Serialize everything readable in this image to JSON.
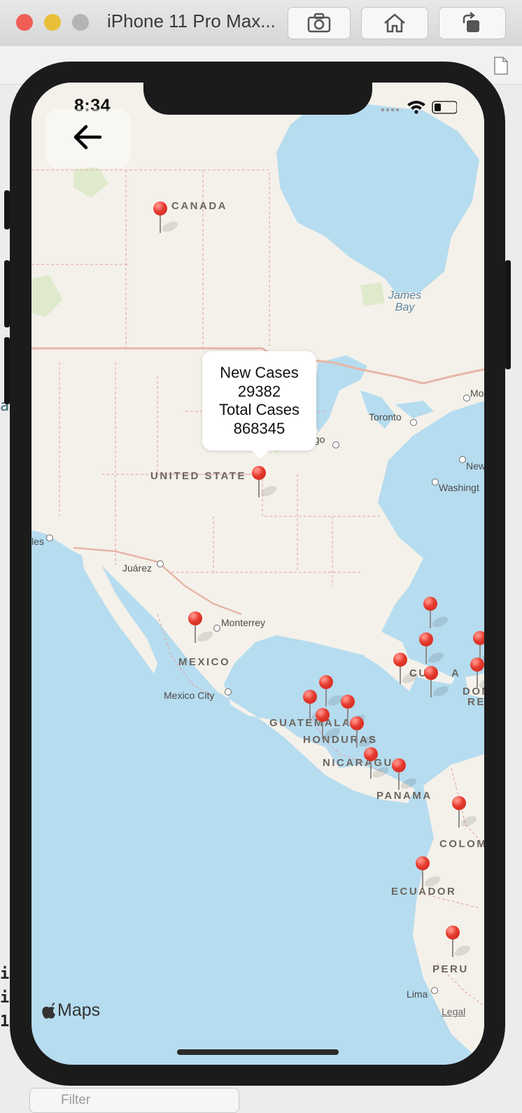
{
  "window": {
    "title": "iPhone 11 Pro Max...",
    "toolbar": [
      "screenshot",
      "home",
      "rotate"
    ]
  },
  "status_bar": {
    "time": "8:34"
  },
  "map": {
    "country_labels": [
      "CANADA",
      "UNITED STATE",
      "MEXICO",
      "GUATEMALA",
      "HONDURAS",
      "NICARAGU",
      "PANAMA",
      "COLOM",
      "ECUADOR",
      "PERU",
      "CU",
      "A",
      "DOM",
      "RE"
    ],
    "city_labels": [
      "Toronto",
      "Chicago",
      "Mo",
      "New",
      "Washingt",
      "les",
      "Juárez",
      "Monterrey",
      "Mexico City",
      "Lima"
    ],
    "water_labels": [
      "James",
      "Bay"
    ],
    "pin_count": 19
  },
  "callout": {
    "line1": "New Cases",
    "line2": "29382",
    "line3": "Total Cases",
    "line4": "868345"
  },
  "attribution": {
    "logo": "Maps",
    "legal": "Legal"
  },
  "background_app": {
    "filter_placeholder": "Filter",
    "left_edge_chars": [
      "a",
      "i",
      "i",
      "1"
    ]
  },
  "colors": {
    "pin": "#e63a2e",
    "water": "#b6dcef",
    "land": "#f4f1ea"
  },
  "icons": [
    "back-arrow-icon",
    "wifi-icon",
    "battery-icon",
    "camera-icon",
    "home-icon",
    "rotate-icon",
    "apple-icon",
    "document-icon"
  ]
}
